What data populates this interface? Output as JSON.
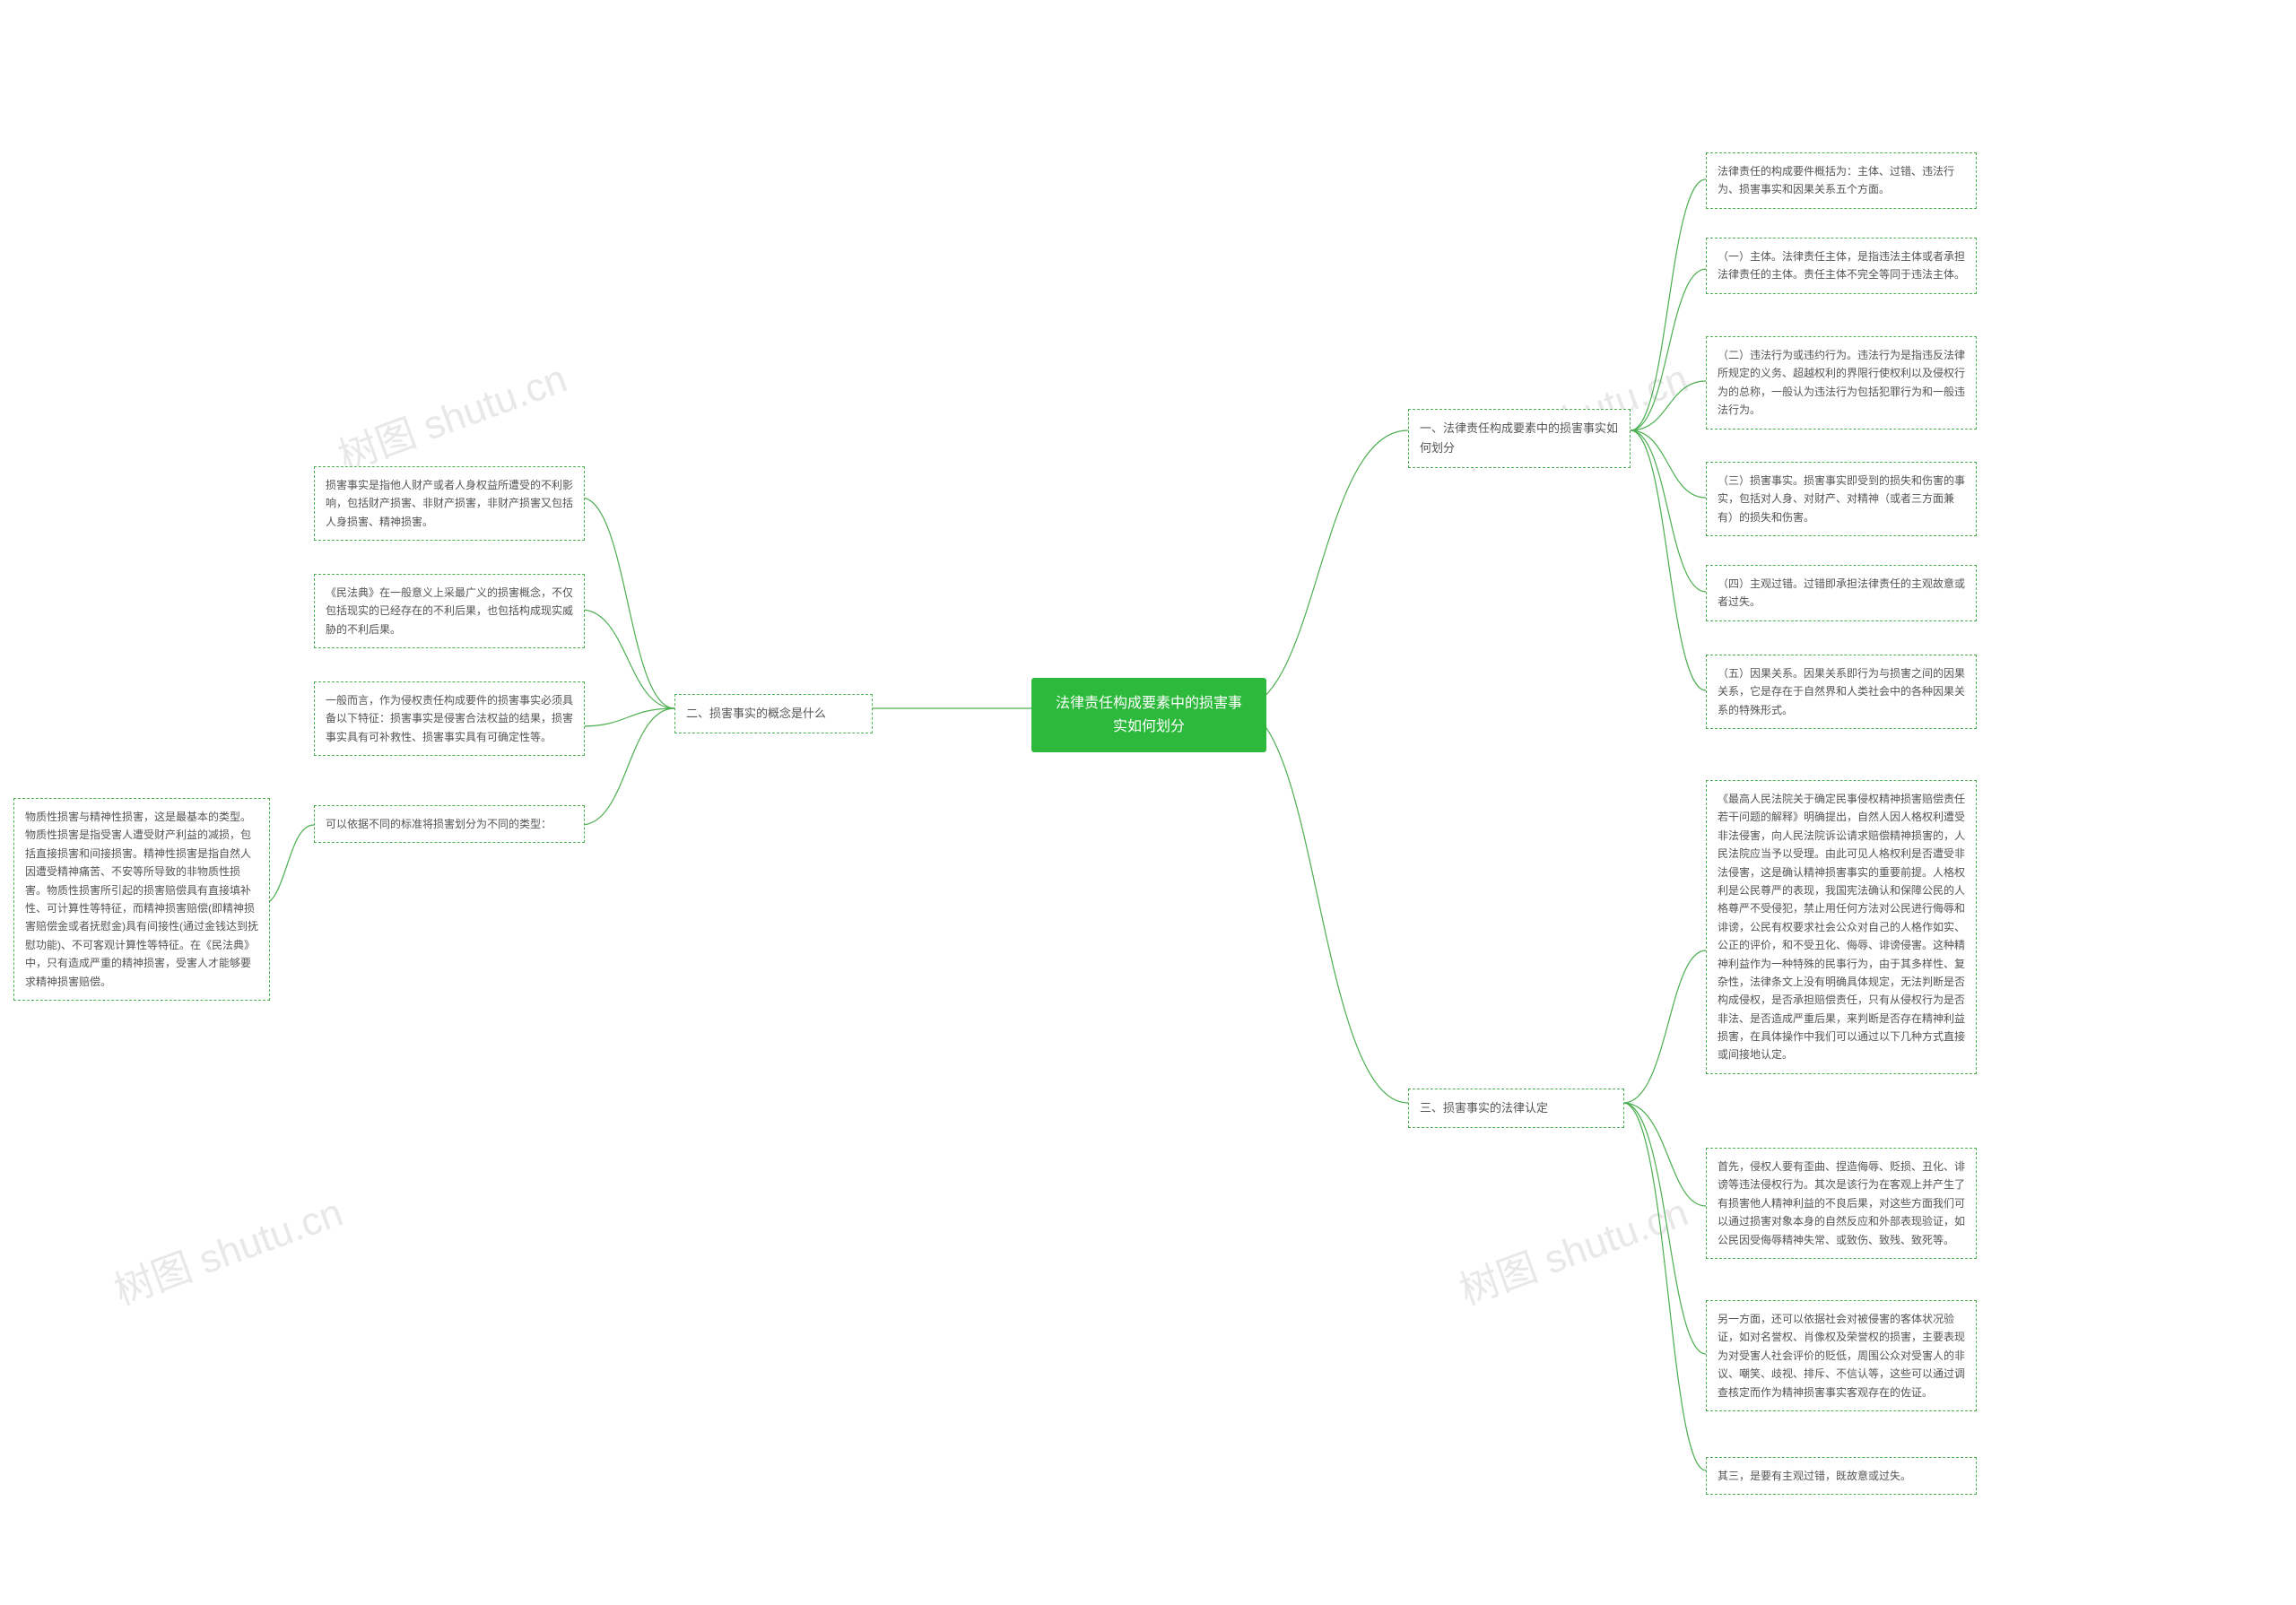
{
  "center": {
    "title": "法律责任构成要素中的损害事实如何划分"
  },
  "branches": {
    "b1": {
      "title": "一、法律责任构成要素中的损害事实如何划分",
      "items": {
        "i1": "法律责任的构成要件概括为：主体、过错、违法行为、损害事实和因果关系五个方面。",
        "i2": "（一）主体。法律责任主体，是指违法主体或者承担法律责任的主体。责任主体不完全等同于违法主体。",
        "i3": "（二）违法行为或违约行为。违法行为是指违反法律所规定的义务、超越权利的界限行使权利以及侵权行为的总称，一般认为违法行为包括犯罪行为和一般违法行为。",
        "i4": "（三）损害事实。损害事实即受到的损失和伤害的事实，包括对人身、对财产、对精神（或者三方面兼有）的损失和伤害。",
        "i5": "（四）主观过错。过错即承担法律责任的主观故意或者过失。",
        "i6": "（五）因果关系。因果关系即行为与损害之间的因果关系，它是存在于自然界和人类社会中的各种因果关系的特殊形式。"
      }
    },
    "b2": {
      "title": "二、损害事实的概念是什么",
      "items": {
        "i1": "损害事实是指他人财产或者人身权益所遭受的不利影响，包括财产损害、非财产损害，非财产损害又包括人身损害、精神损害。",
        "i2": "《民法典》在一般意义上采最广义的损害概念，不仅包括现实的已经存在的不利后果，也包括构成现实威胁的不利后果。",
        "i3": "一般而言，作为侵权责任构成要件的损害事实必须具备以下特征：损害事实是侵害合法权益的结果，损害事实具有可补救性、损害事实具有可确定性等。",
        "i4": "可以依据不同的标准将损害划分为不同的类型：",
        "i5": "物质性损害与精神性损害，这是最基本的类型。物质性损害是指受害人遭受财产利益的减损，包括直接损害和间接损害。精神性损害是指自然人因遭受精神痛苦、不安等所导致的非物质性损害。物质性损害所引起的损害赔偿具有直接填补性、可计算性等特征，而精神损害赔偿(即精神损害赔偿金或者抚慰金)具有间接性(通过金钱达到抚慰功能)、不可客观计算性等特征。在《民法典》中，只有造成严重的精神损害，受害人才能够要求精神损害赔偿。"
      }
    },
    "b3": {
      "title": "三、损害事实的法律认定",
      "items": {
        "i1": "《最高人民法院关于确定民事侵权精神损害赔偿责任若干问题的解释》明确提出，自然人因人格权利遭受非法侵害，向人民法院诉讼请求赔偿精神损害的，人民法院应当予以受理。由此可见人格权利是否遭受非法侵害，这是确认精神损害事实的重要前提。人格权利是公民尊严的表现，我国宪法确认和保障公民的人格尊严不受侵犯，禁止用任何方法对公民进行侮辱和诽谤，公民有权要求社会公众对自己的人格作如实、公正的评价，和不受丑化、侮辱、诽谤侵害。这种精神利益作为一种特殊的民事行为，由于其多样性、复杂性，法律条文上没有明确具体规定，无法判断是否构成侵权，是否承担赔偿责任，只有从侵权行为是否非法、是否造成严重后果，来判断是否存在精神利益损害，在具体操作中我们可以通过以下几种方式直接或间接地认定。",
        "i2": "首先，侵权人要有歪曲、捏造侮辱、贬损、丑化、诽谤等违法侵权行为。其次是该行为在客观上并产生了有损害他人精神利益的不良后果，对这些方面我们可以通过损害对象本身的自然反应和外部表现验证，如公民因受侮辱精神失常、或致伤、致残、致死等。",
        "i3": "另一方面，还可以依据社会对被侵害的客体状况验证，如对名誉权、肖像权及荣誉权的损害，主要表现为对受害人社会评价的贬低，周围公众对受害人的非议、嘲笑、歧视、排斥、不信认等，这些可以通过调查核定而作为精神损害事实客观存在的佐证。",
        "i4": "其三，是要有主观过错，既故意或过失。"
      }
    }
  },
  "watermarks": {
    "text": "树图 shutu.cn"
  }
}
